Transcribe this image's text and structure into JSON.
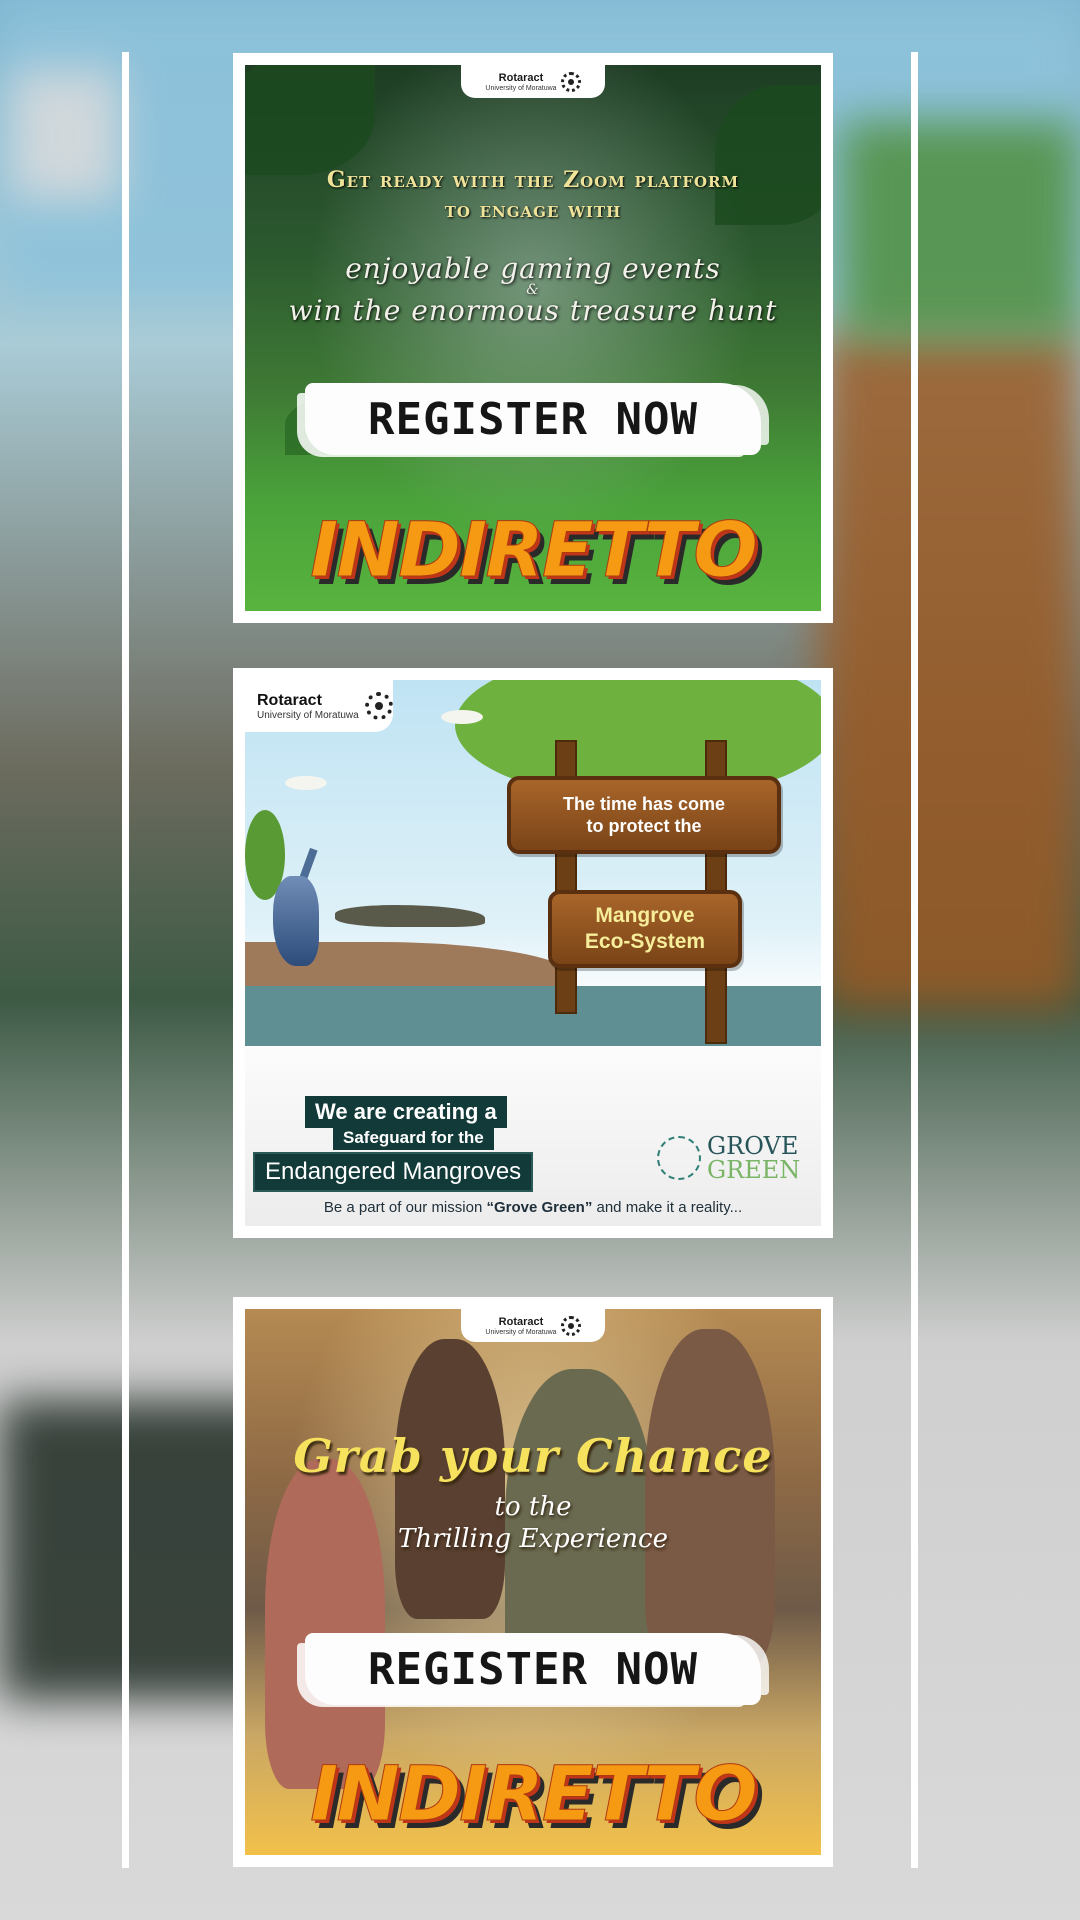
{
  "posters": [
    {
      "rotaract": {
        "name": "Rotaract",
        "org": "University of Moratuwa"
      },
      "headline": [
        "Get ready with the Zoom platform",
        "to engage with"
      ],
      "script": {
        "line1": "enjoyable gaming events",
        "amp": "&",
        "line2": "win the enormous treasure hunt"
      },
      "register": "REGISTER NOW",
      "logo": "INDIRETTO"
    },
    {
      "rotaract": {
        "name": "Rotaract",
        "org": "University of Moratuwa"
      },
      "sign1": [
        "The time has come",
        "to protect the"
      ],
      "sign2": [
        "Mangrove",
        "Eco-System"
      ],
      "banner_line1": "We are creating a",
      "banner_line2": "Safeguard for the",
      "banner_line3": "Endangered Mangroves",
      "brand": [
        "GROVE",
        "GREEN"
      ],
      "footer": {
        "before": "Be a part of our mission ",
        "highlight": "“Grove Green”",
        "after": " and make it a reality..."
      }
    },
    {
      "rotaract": {
        "name": "Rotaract",
        "org": "University of Moratuwa"
      },
      "grab": "Grab your Chance",
      "sub": [
        "to the",
        "Thrilling Experience"
      ],
      "register": "REGISTER NOW",
      "logo": "INDIRETTO"
    }
  ],
  "colors": {
    "accent_yellow": "#f7e25e",
    "logo_orange": "#f59a12",
    "mangrove_teal": "#123a38"
  }
}
